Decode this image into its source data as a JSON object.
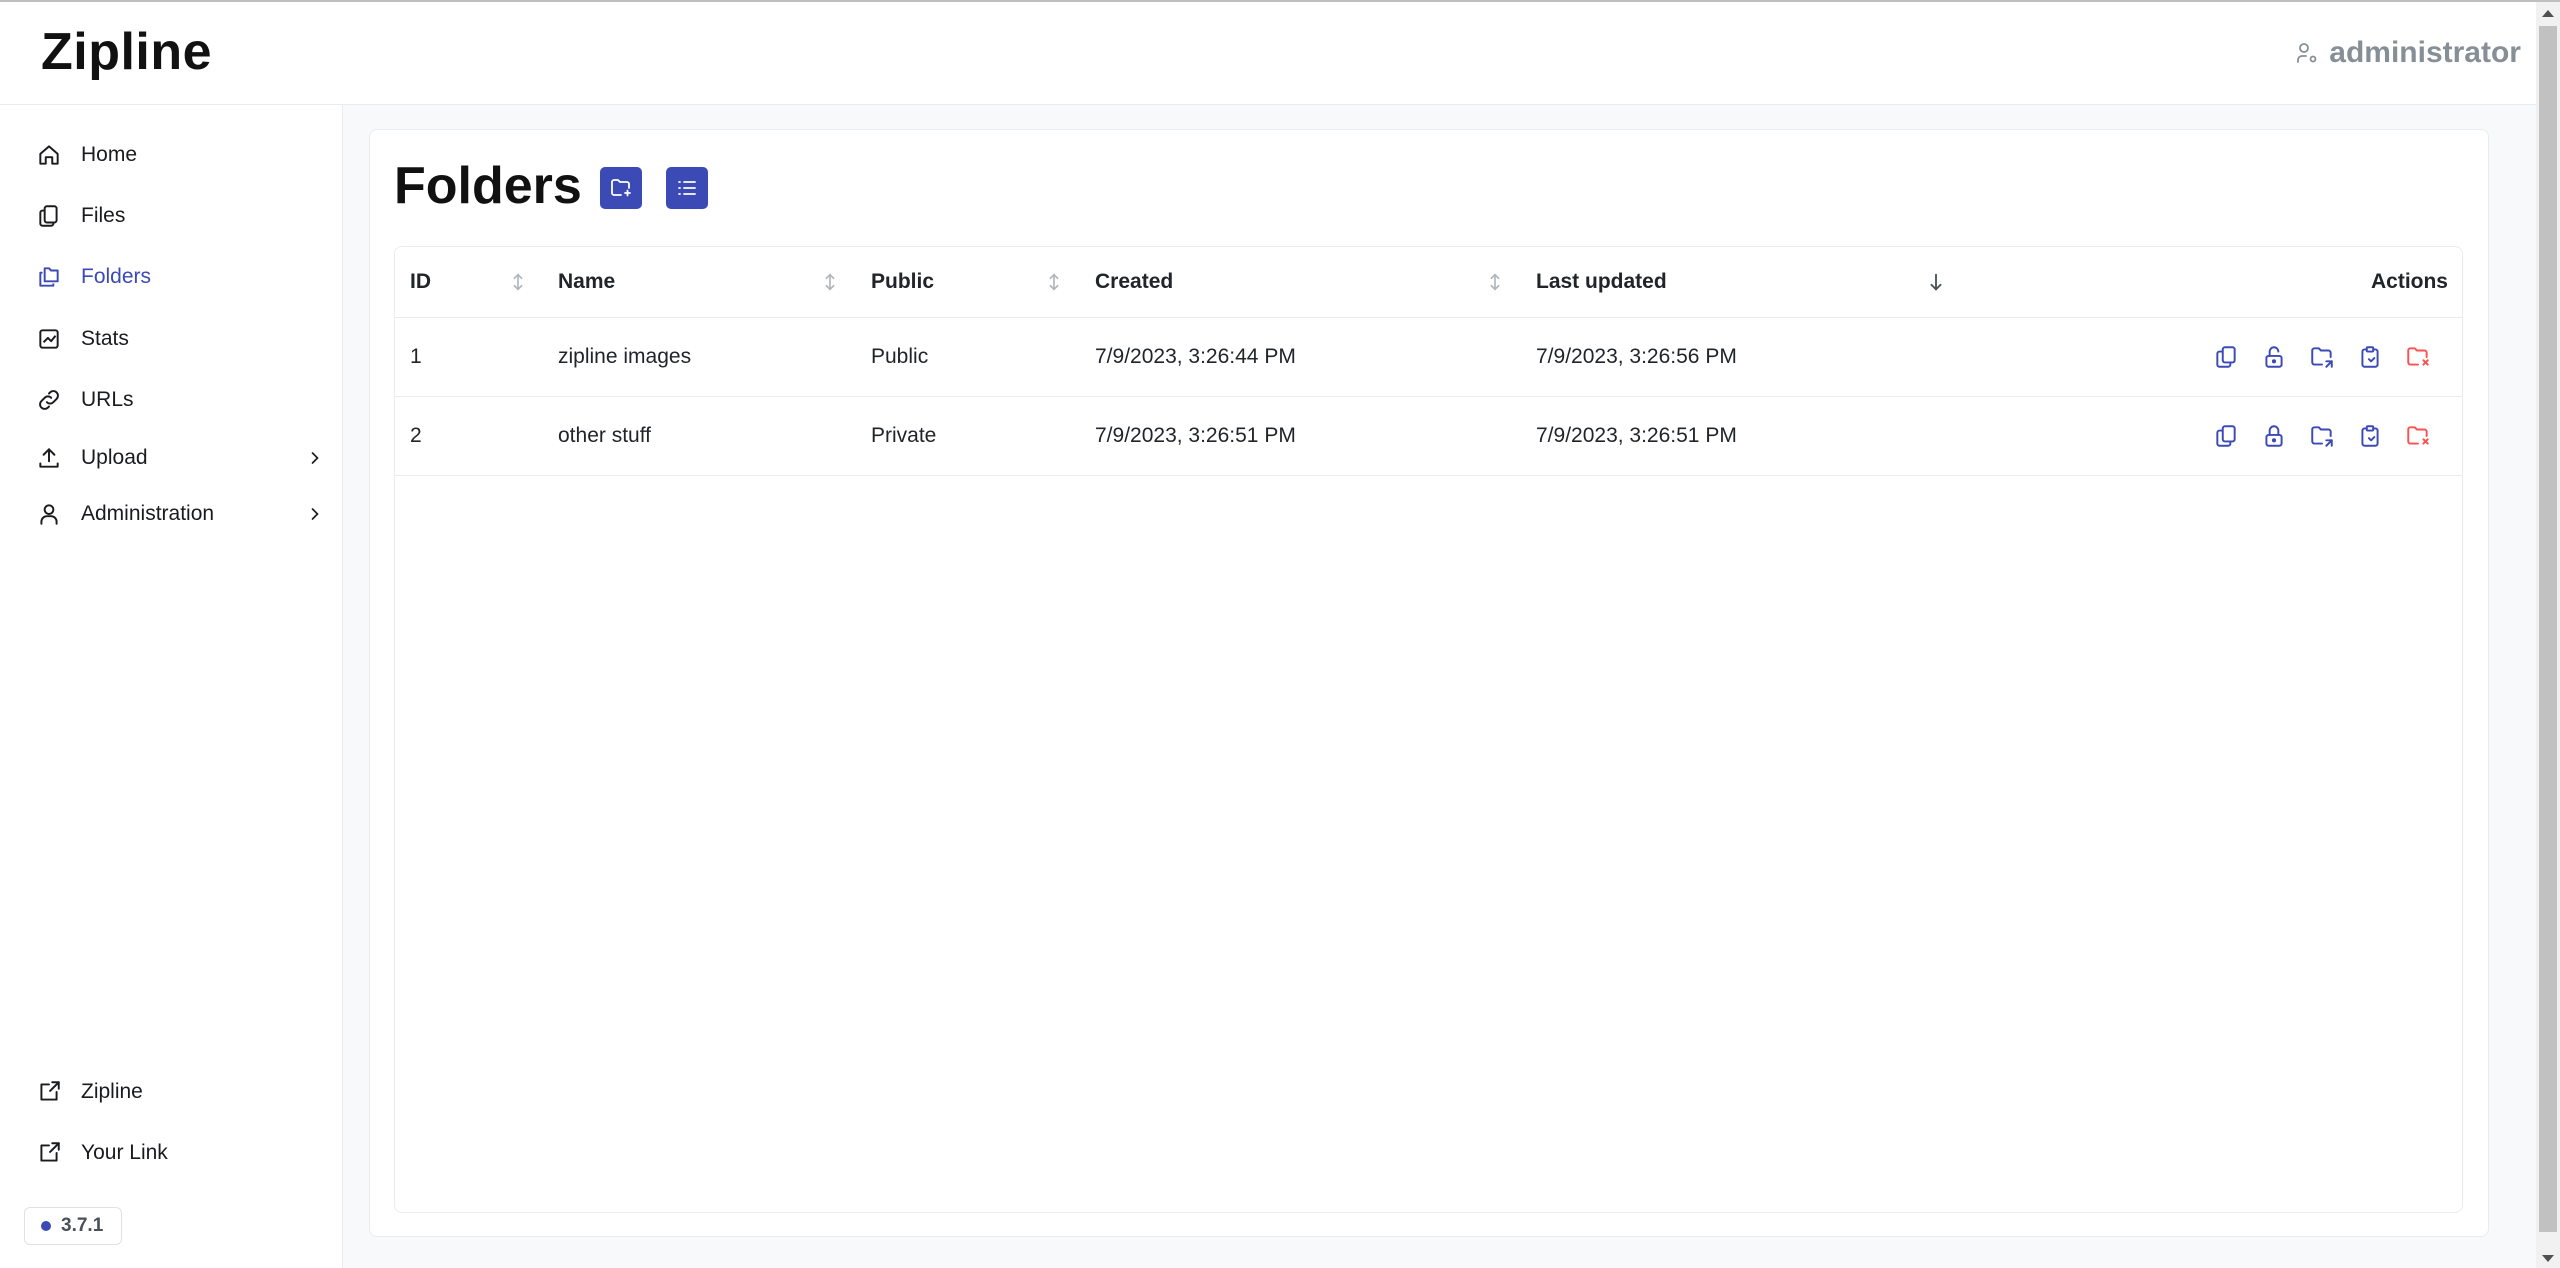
{
  "app": {
    "title": "Zipline",
    "user": "administrator"
  },
  "sidebar": {
    "items": [
      {
        "label": "Home",
        "icon": "home-icon"
      },
      {
        "label": "Files",
        "icon": "files-icon"
      },
      {
        "label": "Folders",
        "icon": "folders-icon",
        "active": true
      },
      {
        "label": "Stats",
        "icon": "stats-icon"
      },
      {
        "label": "URLs",
        "icon": "link-icon"
      },
      {
        "label": "Upload",
        "icon": "upload-icon",
        "expandable": true
      },
      {
        "label": "Administration",
        "icon": "user-icon",
        "expandable": true
      }
    ],
    "footer_links": [
      {
        "label": "Zipline",
        "icon": "external-link-icon"
      },
      {
        "label": "Your Link",
        "icon": "external-link-icon"
      }
    ],
    "version": "3.7.1"
  },
  "page": {
    "title": "Folders",
    "buttons": [
      {
        "icon": "folder-plus-icon"
      },
      {
        "icon": "list-icon"
      }
    ]
  },
  "table": {
    "columns": [
      "ID",
      "Name",
      "Public",
      "Created",
      "Last updated",
      "Actions"
    ],
    "sorted_column": "Last updated",
    "sort_direction": "descending",
    "rows": [
      {
        "id": "1",
        "name": "zipline images",
        "public": "Public",
        "created": "7/9/2023, 3:26:44 PM",
        "updated": "7/9/2023, 3:26:56 PM"
      },
      {
        "id": "2",
        "name": "other stuff",
        "public": "Private",
        "created": "7/9/2023, 3:26:51 PM",
        "updated": "7/9/2023, 3:26:51 PM"
      }
    ],
    "actions": [
      "copy-icon",
      "unlock-icon",
      "folder-share-icon",
      "clipboard-icon",
      "folder-delete-icon"
    ]
  },
  "colors": {
    "accent": "#3b4ab5",
    "danger": "#fa5252",
    "text": "#212529"
  }
}
